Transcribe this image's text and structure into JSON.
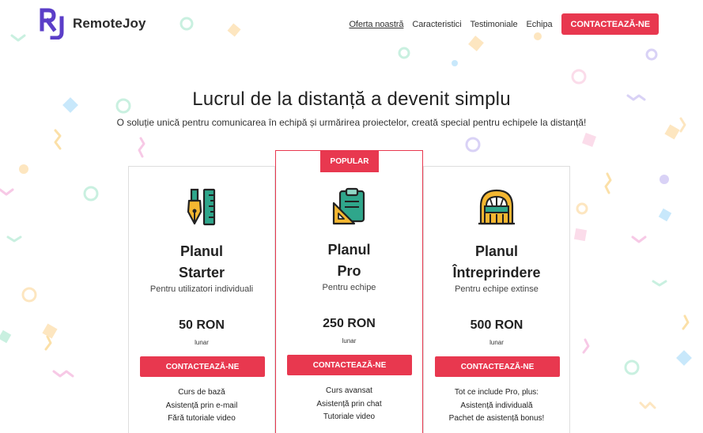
{
  "brand": {
    "name": "RemoteJoy",
    "logo_letters": "RJ"
  },
  "nav": {
    "items": [
      {
        "label": "Oferta noastră",
        "active": true
      },
      {
        "label": "Caracteristici",
        "active": false
      },
      {
        "label": "Testimoniale",
        "active": false
      },
      {
        "label": "Echipa",
        "active": false
      }
    ],
    "cta_label": "CONTACTEAZĂ-NE"
  },
  "hero": {
    "title": "Lucrul de la distanță a devenit simplu",
    "subtitle": "O soluție unică pentru comunicarea în echipă și urmărirea proiectelor, creată special pentru echipele la distanță!"
  },
  "plans": [
    {
      "name_line1": "Planul",
      "name_line2": "Starter",
      "audience": "Pentru utilizatori individuali",
      "price": "50 RON",
      "period": "lunar",
      "button": "CONTACTEAZĂ-NE",
      "icon": "pen-ruler-icon",
      "features": [
        "Curs de bază",
        "Asistență prin e-mail",
        "Fără tutoriale video"
      ]
    },
    {
      "badge": "POPULAR",
      "name_line1": "Planul",
      "name_line2": "Pro",
      "audience": "Pentru echipe",
      "price": "250 RON",
      "period": "lunar",
      "button": "CONTACTEAZĂ-NE",
      "icon": "clipboard-set-square-icon",
      "features": [
        "Curs avansat",
        "Asistență prin chat",
        "Tutoriale video"
      ]
    },
    {
      "name_line1": "Planul",
      "name_line2": "Întreprindere",
      "audience": "Pentru echipe extinse",
      "price": "500 RON",
      "period": "lunar",
      "button": "CONTACTEAZĂ-NE",
      "icon": "building-icon",
      "features": [
        "Tot ce include Pro, plus:",
        "Asistență individuală",
        "Pachet de asistență bonus!"
      ]
    }
  ],
  "colors": {
    "accent": "#e8384f",
    "logo": "#5b3ec8",
    "confetti": [
      "#f7c9e6",
      "#c9f0e0",
      "#fde6c0",
      "#d9d2f6",
      "#c8e8fb",
      "#fbe0a8"
    ]
  }
}
